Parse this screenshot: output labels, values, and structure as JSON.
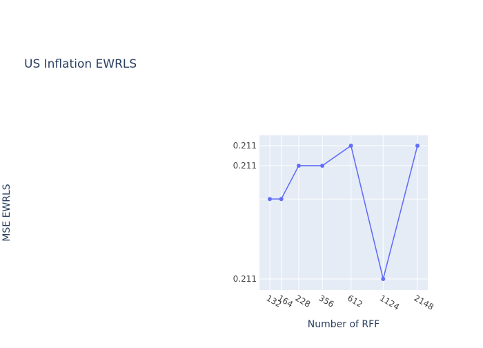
{
  "chart_data": {
    "type": "line",
    "title": "US Inflation EWRLS",
    "xlabel": "Number of RFF",
    "ylabel": "MSE EWRLS",
    "x": [
      132,
      164,
      228,
      356,
      612,
      1124,
      2148
    ],
    "x_tick_labels": [
      "132",
      "164",
      "228",
      "356",
      "612",
      "1124",
      "2148"
    ],
    "y_relative_level": [
      0.6,
      0.6,
      0.85,
      0.85,
      1.0,
      0.0,
      1.0
    ],
    "y_tick_labels": [
      "0.211",
      "0.211",
      "0.211"
    ],
    "y_tick_relative_level": [
      1.0,
      0.85,
      0.0
    ],
    "series": [
      {
        "values_relative": [
          0.6,
          0.6,
          0.85,
          0.85,
          1.0,
          0.0,
          1.0
        ]
      }
    ],
    "grid": true,
    "colors": {
      "line": "#636efa",
      "plot_bg": "#e5ecf6",
      "grid": "#ffffff",
      "text": "#2a3f5f",
      "tick_text": "#444444"
    }
  }
}
